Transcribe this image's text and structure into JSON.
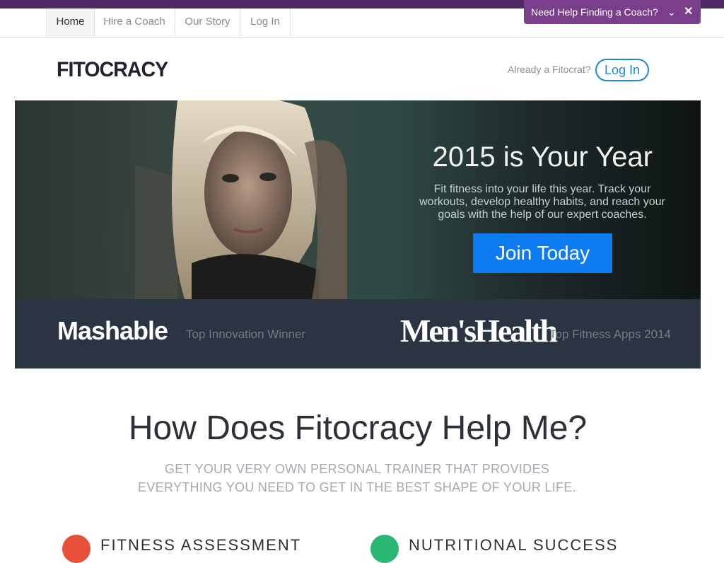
{
  "nav": {
    "tabs": [
      {
        "label": "Home",
        "active": true
      },
      {
        "label": "Hire a Coach",
        "active": false
      },
      {
        "label": "Our Story",
        "active": false
      },
      {
        "label": "Log In",
        "active": false
      }
    ]
  },
  "help_widget": {
    "label": "Need Help Finding a Coach?",
    "chevron_icon": "chevron-down-icon",
    "close_icon": "close-icon"
  },
  "header": {
    "logo": "FITOCRACY",
    "already_text": "Already a Fitocrat?",
    "login_label": "Log In"
  },
  "hero": {
    "title": "2015 is Your Year",
    "subtitle": "Fit fitness into your life this year. Track your workouts, develop healthy habits, and reach your goals with the help of our expert coaches.",
    "cta": "Join Today"
  },
  "press": {
    "items": [
      {
        "logo": "Mashable",
        "caption": "Top Innovation Winner"
      },
      {
        "logo": "Men'sHealth",
        "caption": "Top Fitness Apps 2014"
      }
    ]
  },
  "how": {
    "heading": "How Does Fitocracy Help Me?",
    "subheading": "GET YOUR VERY OWN PERSONAL TRAINER THAT PROVIDES EVERYTHING YOU NEED TO GET IN THE BEST SHAPE OF YOUR LIFE."
  },
  "features": [
    {
      "label": "FITNESS ASSESSMENT",
      "color": "#e8503a"
    },
    {
      "label": "NUTRITIONAL SUCCESS",
      "color": "#2bb673"
    }
  ],
  "colors": {
    "top_strip": "#4d2a63",
    "help_bg": "#7a3e8a",
    "accent_blue": "#0d7cf0",
    "press_bg": "#2a3442"
  }
}
